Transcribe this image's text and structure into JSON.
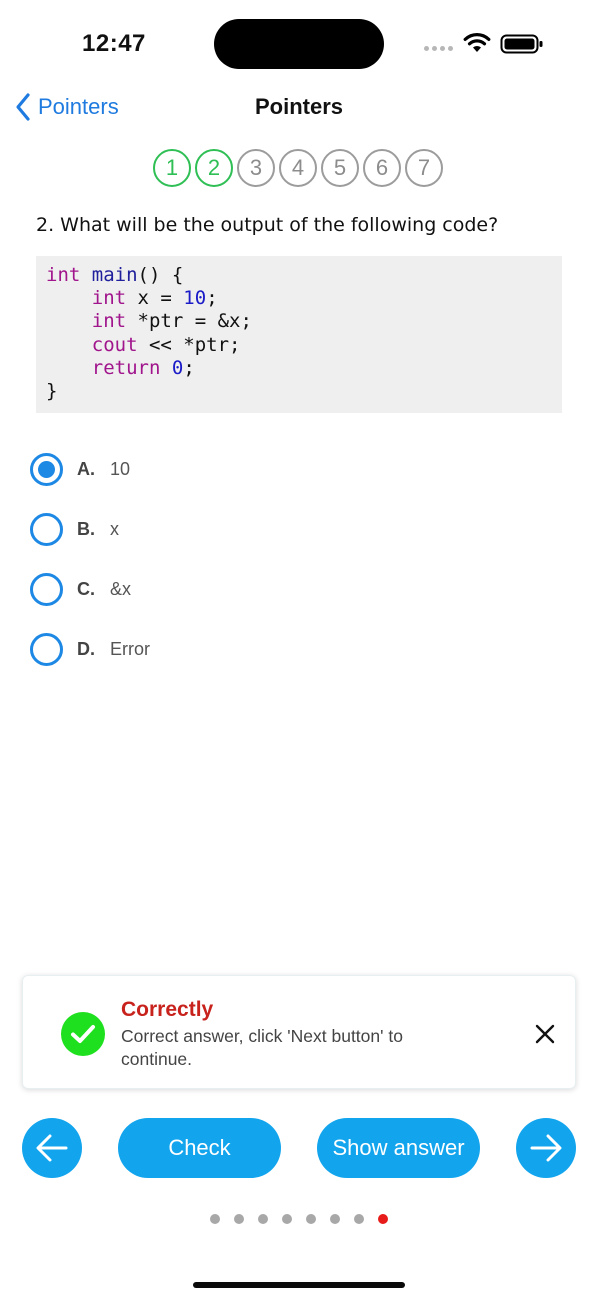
{
  "status_bar": {
    "time": "12:47"
  },
  "nav": {
    "back_label": "Pointers",
    "title": "Pointers"
  },
  "stepper": {
    "steps": [
      {
        "label": "1",
        "state": "done"
      },
      {
        "label": "2",
        "state": "done"
      },
      {
        "label": "3",
        "state": "pending"
      },
      {
        "label": "4",
        "state": "pending"
      },
      {
        "label": "5",
        "state": "pending"
      },
      {
        "label": "6",
        "state": "pending"
      },
      {
        "label": "7",
        "state": "pending"
      }
    ]
  },
  "question": {
    "text": "2. What will be the output of the following code?",
    "code_lines": [
      "int main() {",
      "    int x = 10;",
      "    int *ptr = &x;",
      "    cout << *ptr;",
      "    return 0;",
      "}"
    ]
  },
  "options": [
    {
      "letter": "A.",
      "text": "10",
      "selected": true
    },
    {
      "letter": "B.",
      "text": "x",
      "selected": false
    },
    {
      "letter": "C.",
      "text": "&x",
      "selected": false
    },
    {
      "letter": "D.",
      "text": "Error",
      "selected": false
    }
  ],
  "toast": {
    "title": "Correctly",
    "message": "Correct answer, click 'Next button' to continue."
  },
  "controls": {
    "check_label": "Check",
    "show_answer_label": "Show answer"
  },
  "pagination": {
    "total": 8,
    "active_index": 7
  },
  "colors": {
    "accent": "#12a5ee",
    "link": "#1f7be0",
    "radio": "#1e88e5",
    "step_done": "#2fbf55",
    "success": "#1ee01e",
    "error_title": "#c8221d",
    "active_dot": "#e81b1b"
  },
  "icons": {
    "back": "chevron-left-icon",
    "wifi": "wifi-icon",
    "battery": "battery-icon",
    "toast": "check-circle-icon",
    "close": "close-icon",
    "prev": "arrow-left-icon",
    "next": "arrow-right-icon"
  }
}
